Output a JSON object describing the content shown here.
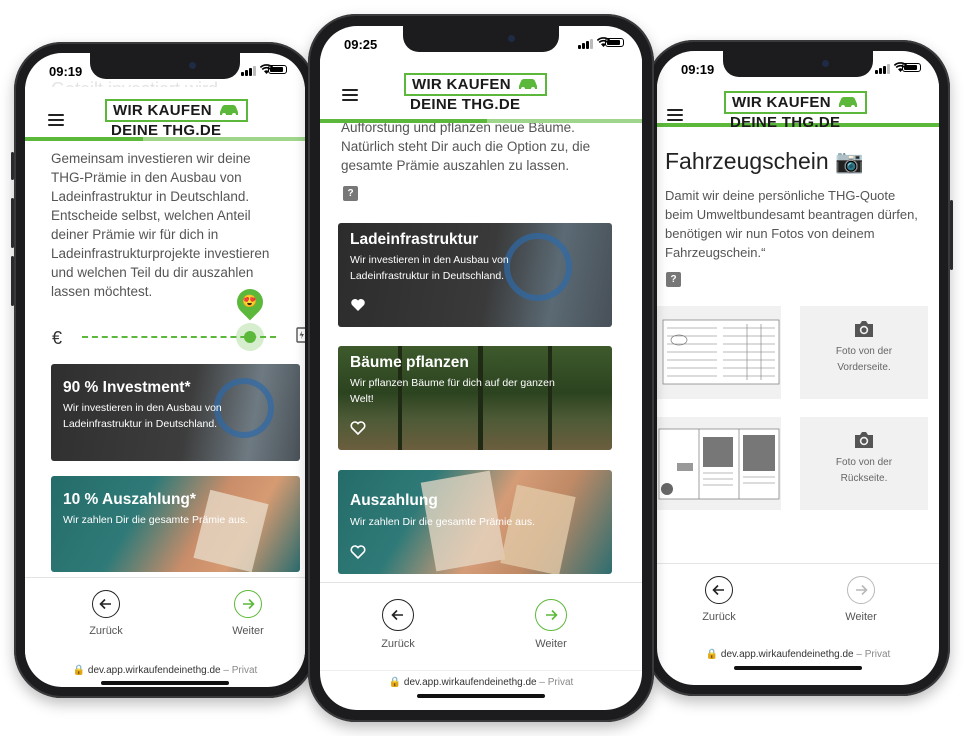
{
  "status": {
    "left_time": "09:19",
    "middle_time": "09:25",
    "right_time": "09:19"
  },
  "logo": {
    "line1": "WIR KAUFEN",
    "line2": "DEINE THG.DE",
    "brand_color": "#5cb83a"
  },
  "left_screen": {
    "clipped_text": "Geteilt investiert wird",
    "paragraph": "Gemeinsam investieren wir deine THG-Prämie in den Ausbau von Ladeinfrastruktur in Deutschland. Entscheide selbst, welchen Anteil deiner Prämie wir für dich in Ladeinfrastrukturprojekte investieren und welchen Teil du dir auszahlen lassen möchtest.",
    "slider": {
      "left_icon": "€",
      "right_icon": "charging-station-icon",
      "thumb_emoji": "😍",
      "investment_share": 0.9
    },
    "cards": [
      {
        "title": "90 % Investment*",
        "description": "Wir investieren in den Ausbau von Ladeinfrastruktur in Deutschland."
      },
      {
        "title": "10 % Auszahlung*",
        "description": "Wir zahlen Dir die gesamte Prämie aus."
      }
    ]
  },
  "middle_screen": {
    "paragraph": "Aufforstung und pflanzen neue Bäume. Natürlich steht Dir auch die Option zu, die gesamte Prämie auszahlen zu lassen.",
    "help": "?",
    "cards": [
      {
        "title": "Ladeinfrastruktur",
        "description": "Wir investieren in den Ausbau von Ladeinfrastruktur in Deutschland."
      },
      {
        "title": "Bäume pflanzen",
        "description": "Wir pflanzen Bäume für dich auf der ganzen Welt!"
      },
      {
        "title": "Auszahlung",
        "description": "Wir zahlen Dir die gesamte Prämie aus."
      }
    ]
  },
  "right_screen": {
    "heading": "Fahrzeugschein 📷",
    "paragraph": "Damit wir deine persönliche THG-Quote beim Umweltbundesamt beantragen dürfen, benötigen wir nun Fotos von deinem Fahrzeugschein.“",
    "help": "?",
    "front_label": "Foto von der Vorderseite.",
    "back_label": "Foto von der Rückseite."
  },
  "nav": {
    "back": "Zurück",
    "next": "Weiter"
  },
  "url": {
    "domain": "dev.app.wirkaufendeinethg.de",
    "suffix": "– Privat"
  }
}
